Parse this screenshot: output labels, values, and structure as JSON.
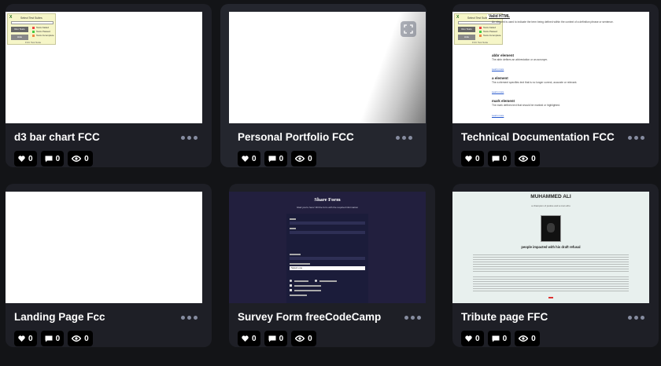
{
  "pens": [
    {
      "title": "d3 bar chart FCC",
      "likes": "0",
      "comments": "0",
      "views": "0"
    },
    {
      "title": "Personal Portfolio FCC",
      "likes": "0",
      "comments": "0",
      "views": "0"
    },
    {
      "title": "Technical Documentation FCC",
      "likes": "0",
      "comments": "0",
      "views": "0"
    },
    {
      "title": "Landing Page Fcc",
      "likes": "0",
      "comments": "0",
      "views": "0"
    },
    {
      "title": "Survey Form freeCodeCamp",
      "likes": "0",
      "comments": "0",
      "views": "0"
    },
    {
      "title": "Tribute page FFC",
      "likes": "0",
      "comments": "0",
      "views": "0"
    }
  ],
  "previews": {
    "widget": {
      "close": "X",
      "title": "Select Test Suites",
      "run": "Run Tests",
      "hide": "Hide",
      "legend": [
        "Tests Failed",
        "Tests Passed",
        "Tests Incomplete"
      ],
      "footer": "FCC Test Suite"
    },
    "tech_doc": {
      "heading": "Valid HTML",
      "sections": [
        {
          "h": "",
          "p": "An element is used to indicate the term being defined within the context of a definition phrase or sentence."
        },
        {
          "h": "abbr element",
          "p": "The abbr defines an abbreviation or an acronym."
        },
        {
          "h": "a element",
          "p": "The a element specifies text that is no longer correct, accurate or relevant."
        },
        {
          "h": "mark element",
          "p": "The mark defines text that should be marked or highlighted."
        }
      ],
      "link": "Learn more"
    },
    "survey": {
      "heading": "Share Form",
      "sub": "Glad you're here! Fill the form with the required information",
      "select": "Select one",
      "button": "Submit"
    },
    "tribute": {
      "heading": "MUHAMMED ALI",
      "sub": "a champion of justice and a man who",
      "caption": "people impacted with his draft refusal"
    }
  },
  "colors": {
    "background": "#131417",
    "card": "#1e1f26",
    "stat_pill": "#000000",
    "muted": "#868ca0"
  }
}
